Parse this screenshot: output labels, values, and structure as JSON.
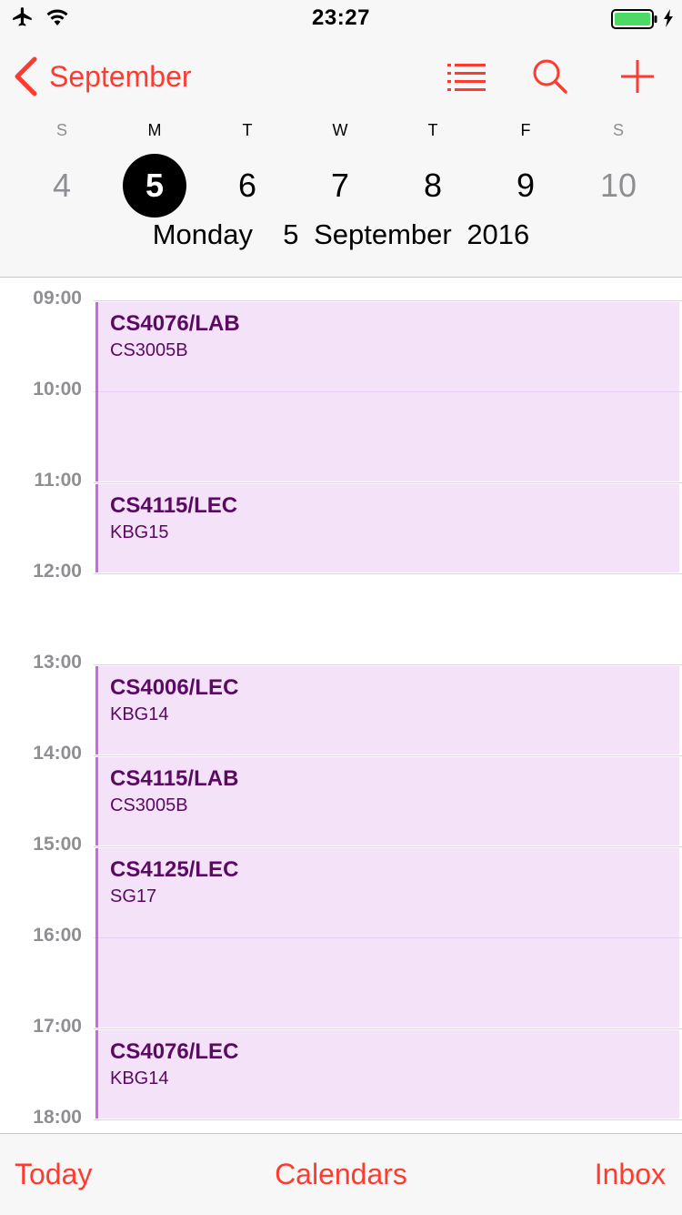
{
  "status_bar": {
    "time": "23:27",
    "icons": [
      "airplane-icon",
      "wifi-icon",
      "battery-icon",
      "charging-bolt-icon"
    ]
  },
  "nav": {
    "back_label": "September",
    "icons": [
      "back-chevron-icon",
      "list-icon",
      "search-icon",
      "add-icon"
    ]
  },
  "week": {
    "day_letters": [
      "S",
      "M",
      "T",
      "W",
      "T",
      "F",
      "S"
    ],
    "day_numbers": [
      "4",
      "5",
      "6",
      "7",
      "8",
      "9",
      "10"
    ],
    "selected": "5"
  },
  "date_title": "Monday  5 September 2016",
  "hours": [
    "09:00",
    "10:00",
    "11:00",
    "12:00",
    "13:00",
    "14:00",
    "15:00",
    "16:00",
    "17:00",
    "18:00"
  ],
  "events": [
    {
      "title": "CS4076/LAB",
      "location": "CS3005B",
      "start": "09:00",
      "end": "11:00"
    },
    {
      "title": "CS4115/LEC",
      "location": "KBG15",
      "start": "11:00",
      "end": "12:00"
    },
    {
      "title": "CS4006/LEC",
      "location": "KBG14",
      "start": "13:00",
      "end": "14:00"
    },
    {
      "title": "CS4115/LAB",
      "location": "CS3005B",
      "start": "14:00",
      "end": "15:00"
    },
    {
      "title": "CS4125/LEC",
      "location": "SG17",
      "start": "15:00",
      "end": "17:00"
    },
    {
      "title": "CS4076/LEC",
      "location": "KBG14",
      "start": "17:00",
      "end": "18:00"
    }
  ],
  "tabbar": {
    "today": "Today",
    "calendars": "Calendars",
    "inbox": "Inbox"
  },
  "colors": {
    "accent": "#ff3b30",
    "event_bg": "#f4e2f8",
    "event_border": "#c969e0",
    "event_text": "#5a0a63"
  }
}
